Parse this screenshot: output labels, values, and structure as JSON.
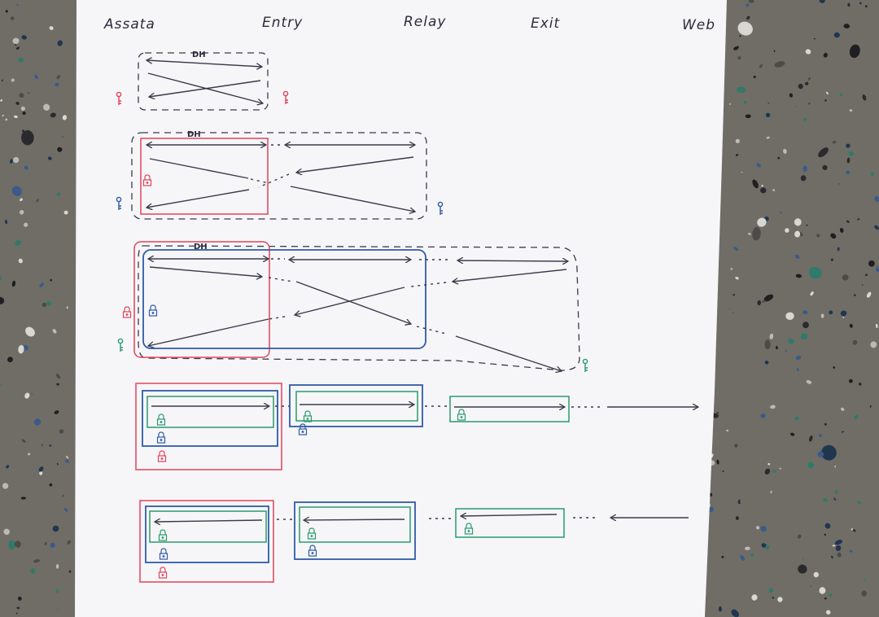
{
  "nodes": [
    "Assata",
    "Entry",
    "Relay",
    "Exit",
    "Web"
  ],
  "dh_label": "DH",
  "colors": {
    "red": "#e0445a",
    "blue": "#2f5aa8",
    "green": "#2a9a6e",
    "ink": "#3a3a4c",
    "paper": "#f6f6f8",
    "table": "#6f6d66"
  },
  "icons": [
    "key-icon",
    "lock-icon"
  ]
}
